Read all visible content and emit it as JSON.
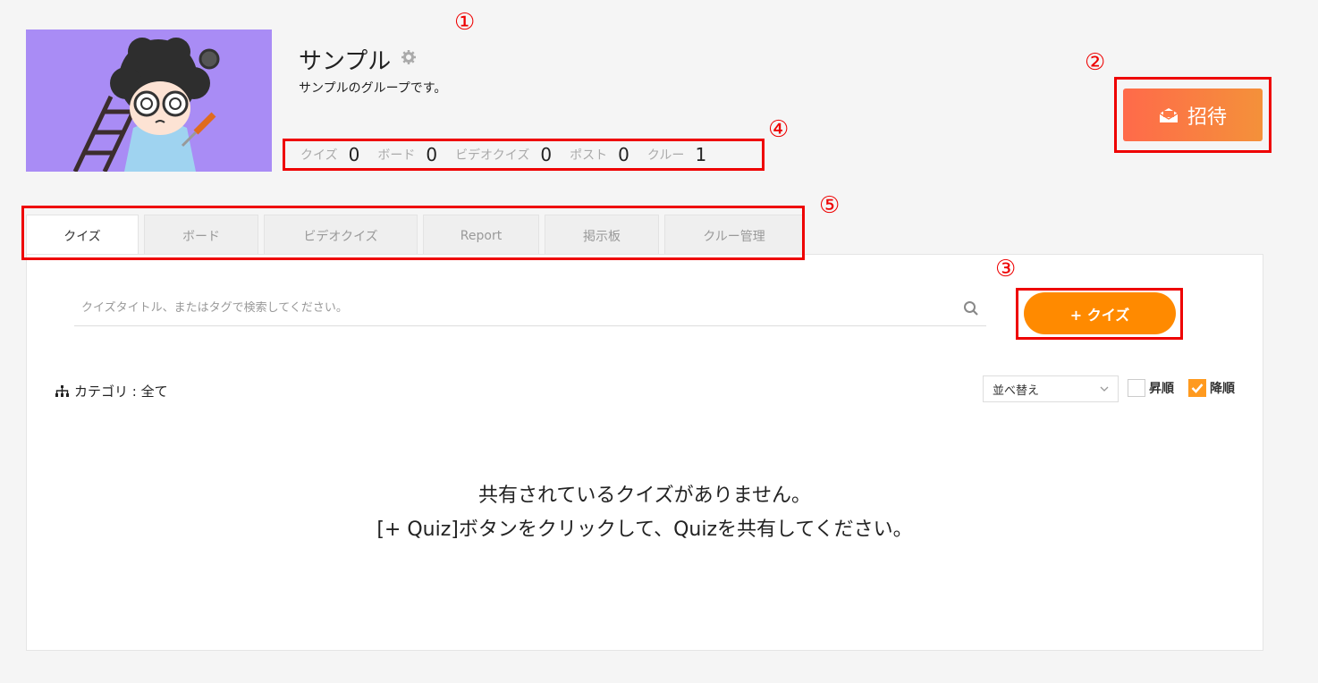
{
  "group": {
    "name": "サンプル",
    "description": "サンプルのグループです。"
  },
  "stats": [
    {
      "label": "クイズ",
      "value": "0"
    },
    {
      "label": "ボード",
      "value": "0"
    },
    {
      "label": "ビデオクイズ",
      "value": "0"
    },
    {
      "label": "ポスト",
      "value": "0"
    },
    {
      "label": "クルー",
      "value": "1"
    }
  ],
  "invite_label": "招待",
  "tabs": [
    {
      "label": "クイズ"
    },
    {
      "label": "ボード"
    },
    {
      "label": "ビデオクイズ"
    },
    {
      "label": "Report"
    },
    {
      "label": "掲示板"
    },
    {
      "label": "クルー管理"
    }
  ],
  "search": {
    "placeholder": "クイズタイトル、またはタグで検索してください。"
  },
  "add_quiz_label": "+ クイズ",
  "category_label": "カテゴリ : 全て",
  "sort": {
    "selected": "並べ替え",
    "asc_label": "昇順",
    "desc_label": "降順"
  },
  "empty": {
    "line1": "共有されているクイズがありません。",
    "line2": "[+ Quiz]ボタンをクリックして、Quizを共有してください。"
  },
  "markers": [
    "①",
    "②",
    "③",
    "④",
    "⑤"
  ],
  "colors": {
    "accent": "#ff8a00",
    "invite_start": "#ff6a4a",
    "invite_end": "#f4913a",
    "annotation": "#e00000",
    "avatar_bg": "#a98cf5"
  },
  "icons": [
    "gear-icon",
    "envelope-icon",
    "search-icon",
    "tree-icon",
    "chevron-down-icon",
    "check-icon"
  ]
}
